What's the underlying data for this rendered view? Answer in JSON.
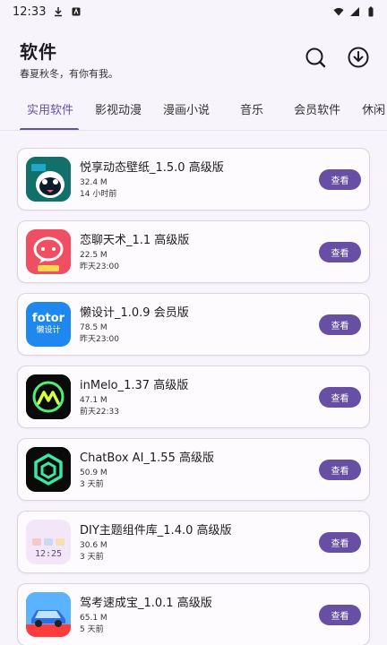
{
  "status_bar": {
    "time": "12:33"
  },
  "header": {
    "title": "软件",
    "subtitle": "春夏秋冬，有你有我。"
  },
  "tabs": [
    "实用软件",
    "影视动漫",
    "漫画小说",
    "音乐",
    "会员软件",
    "休闲"
  ],
  "active_tab": "实用软件",
  "apps": [
    {
      "name": "悦享动态壁纸_1.5.0 高级版",
      "size": "32.4 M",
      "time": "14 小时前",
      "button": "查看",
      "icon": "penguin-wallpaper-icon"
    },
    {
      "name": "恋聊天术_1.1 高级版",
      "size": "22.5 M",
      "time": "昨天23:00",
      "button": "查看",
      "icon": "chat-bubble-icon"
    },
    {
      "name": "懒设计_1.0.9 会员版",
      "size": "78.5 M",
      "time": "昨天23:00",
      "button": "查看",
      "icon": "fotor-design-icon",
      "icon_text_1": "fotor",
      "icon_text_2": "懒设计"
    },
    {
      "name": "inMelo_1.37 高级版",
      "size": "47.1 M",
      "time": "前天22:33",
      "button": "查看",
      "icon": "inmelo-icon"
    },
    {
      "name": "ChatBox AI_1.55 高级版",
      "size": "50.9 M",
      "time": "3 天前",
      "button": "查看",
      "icon": "chatbox-hexagon-icon"
    },
    {
      "name": "DIY主题组件库_1.4.0 高级版",
      "size": "30.6 M",
      "time": "3 天前",
      "button": "查看",
      "icon": "diy-widget-icon",
      "icon_text_1": "12:25"
    },
    {
      "name": "驾考速成宝_1.0.1 高级版",
      "size": "65.1 M",
      "time": "5 天前",
      "button": "查看",
      "icon": "car-exam-icon"
    }
  ],
  "colors": {
    "accent": "#6750a4",
    "background": "#f8f4fb"
  }
}
